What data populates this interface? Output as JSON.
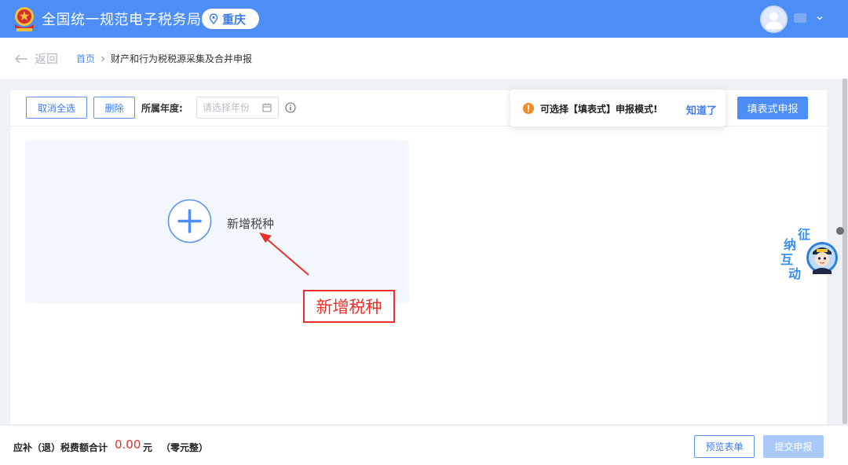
{
  "header": {
    "title": "全国统一规范电子税务局",
    "region": "重庆",
    "icons": {
      "emblem": "national-emblem-icon",
      "pin": "location-pin-icon",
      "avatar": "user-avatar-icon",
      "caret": "chevron-down-icon"
    }
  },
  "nav": {
    "back_label": "返回",
    "breadcrumb": {
      "home": "首页",
      "current": "财产和行为税税源采集及合并申报"
    }
  },
  "toolbar": {
    "cancel_all_label": "取消全选",
    "delete_label": "删除",
    "year_label": "所属年度:",
    "year_placeholder": "请选择年份",
    "year_value": "",
    "form_filing_label": "填表式申报"
  },
  "tooltip": {
    "message": "可选择【填表式】申报模式!",
    "dismiss_label": "知道了"
  },
  "main": {
    "add_tax_label": "新增税种"
  },
  "annotation": {
    "callout_text": "新增税种"
  },
  "widget": {
    "chars": [
      "征",
      "纳",
      "互",
      "动"
    ]
  },
  "footer": {
    "total_label": "应补（退）税费额合计",
    "total_amount": "0.00",
    "total_unit": "元",
    "total_in_words": "（零元整）",
    "preview_label": "预览表单",
    "submit_label": "提交申报"
  },
  "colors": {
    "brand_blue": "#4c8df6",
    "alert_red": "#e8312b",
    "warning_orange": "#f08a24",
    "card_bg": "#f1f7fd",
    "disabled_blue": "#a9c9f8"
  }
}
